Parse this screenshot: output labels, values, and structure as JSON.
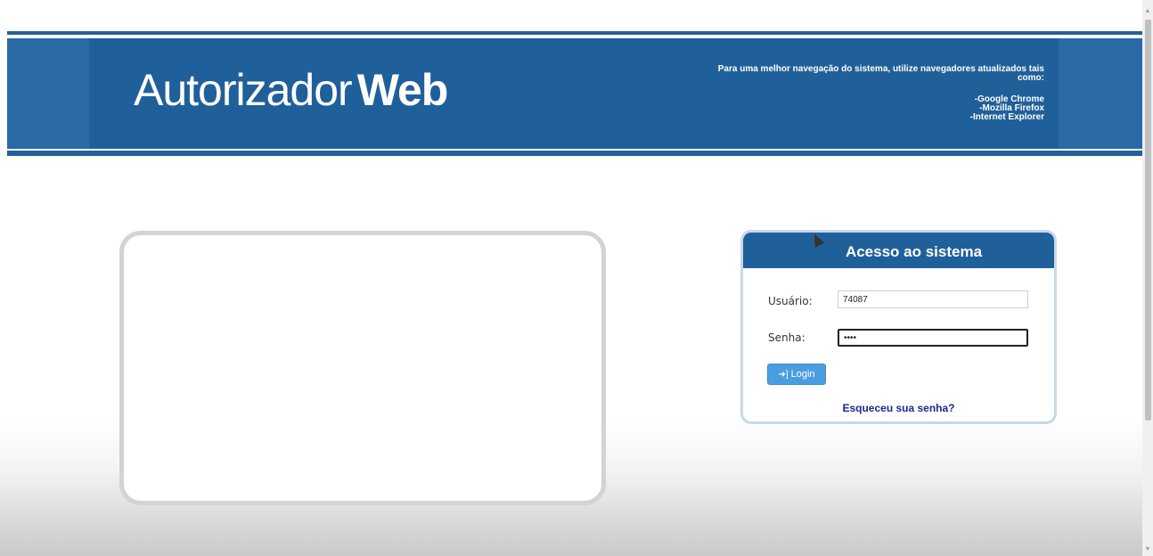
{
  "header": {
    "logo_light": "Autorizador",
    "logo_bold": "Web",
    "browser_note": "Para uma melhor navegação do sistema, utilize navegadores atualizados tais como:",
    "browsers": [
      "-Google Chrome",
      "-Mozilla Firefox",
      "-Internet Explorer"
    ]
  },
  "login": {
    "title": "Acesso ao sistema",
    "username_label": "Usuário:",
    "username_value": "74087",
    "password_label": "Senha:",
    "password_value": "••••",
    "login_button": "Login",
    "login_icon": "sign-in-icon",
    "forgot_link": "Esqueceu sua senha?"
  },
  "colors": {
    "header_blue": "#20609a",
    "button_blue": "#4a9ee0",
    "link_blue": "#1a2a8a"
  }
}
